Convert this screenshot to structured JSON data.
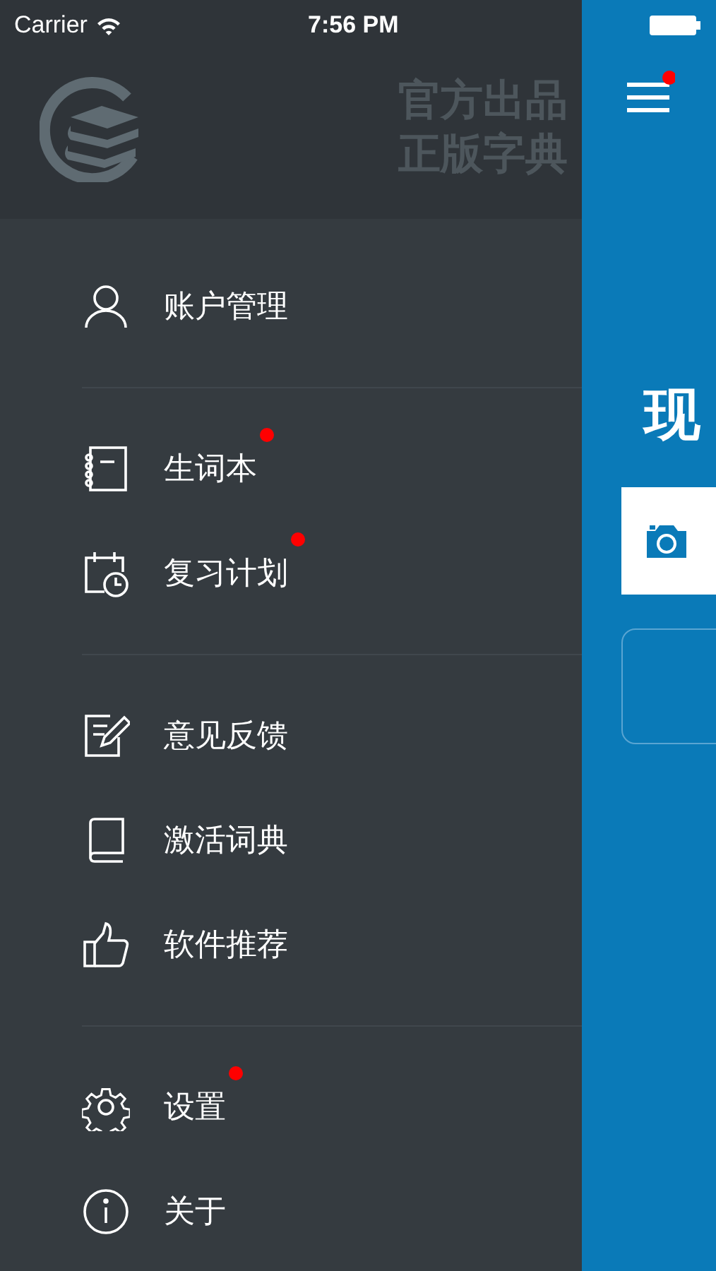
{
  "status_bar": {
    "carrier": "Carrier",
    "time": "7:56 PM"
  },
  "drawer": {
    "slogan": [
      "官方出品",
      "正版字典"
    ],
    "groups": [
      {
        "items": [
          {
            "label": "账户管理",
            "kind": "person",
            "badge": false
          }
        ]
      },
      {
        "items": [
          {
            "label": "生词本",
            "kind": "notebook",
            "badge": true
          },
          {
            "label": "复习计划",
            "kind": "calendar",
            "badge": true
          }
        ]
      },
      {
        "items": [
          {
            "label": "意见反馈",
            "kind": "edit",
            "badge": false
          },
          {
            "label": "激活词典",
            "kind": "book",
            "badge": false
          },
          {
            "label": "软件推荐",
            "kind": "thumb",
            "badge": false
          }
        ]
      },
      {
        "items": [
          {
            "label": "设置",
            "kind": "gear",
            "badge": true
          },
          {
            "label": "关于",
            "kind": "info",
            "badge": false
          }
        ]
      }
    ]
  },
  "main": {
    "menu_badge": true,
    "title": "现"
  }
}
